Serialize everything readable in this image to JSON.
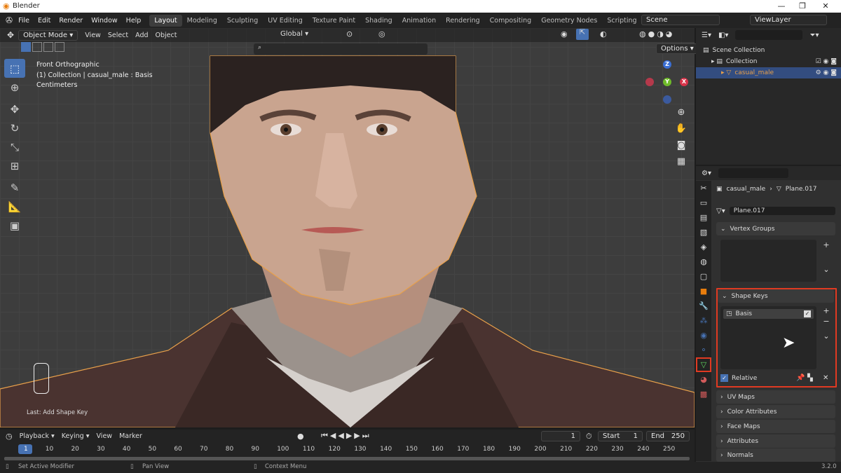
{
  "app": {
    "title": "Blender",
    "version": "3.2.0"
  },
  "menu": [
    "File",
    "Edit",
    "Render",
    "Window",
    "Help"
  ],
  "workspaces": [
    "Layout",
    "Modeling",
    "Sculpting",
    "UV Editing",
    "Texture Paint",
    "Shading",
    "Animation",
    "Rendering",
    "Compositing",
    "Geometry Nodes",
    "Scripting"
  ],
  "workspaces_active": "Layout",
  "scene": "Scene",
  "view_layer": "ViewLayer",
  "viewport": {
    "mode": "Object Mode",
    "menus": [
      "View",
      "Select",
      "Add",
      "Object"
    ],
    "transform": "Global",
    "options": "Options",
    "info": [
      "Front Orthographic",
      "(1) Collection | casual_male : Basis",
      "Centimeters"
    ],
    "last_op": "Last: Add Shape Key",
    "gizmo": {
      "x": "X",
      "y": "Y",
      "z": "Z"
    }
  },
  "outliner": {
    "rows": [
      "Scene Collection",
      "Collection",
      "casual_male"
    ]
  },
  "properties": {
    "breadcrumb_object": "casual_male",
    "breadcrumb_mesh": "Plane.017",
    "mesh_name": "Plane.017",
    "vertex_groups": "Vertex Groups",
    "shape_keys": "Shape Keys",
    "shape_key_item": "Basis",
    "relative": "Relative",
    "panels": [
      "UV Maps",
      "Color Attributes",
      "Face Maps",
      "Attributes",
      "Normals"
    ]
  },
  "timeline": {
    "menus": [
      "Playback",
      "Keying",
      "View",
      "Marker"
    ],
    "current": "1",
    "start_label": "Start",
    "start": "1",
    "end_label": "End",
    "end": "250",
    "frames": [
      "1",
      "10",
      "20",
      "30",
      "40",
      "50",
      "60",
      "70",
      "80",
      "90",
      "100",
      "110",
      "120",
      "130",
      "140",
      "150",
      "160",
      "170",
      "180",
      "190",
      "200",
      "210",
      "220",
      "230",
      "240",
      "250"
    ]
  },
  "status": {
    "left": "Set Active Modifier",
    "mid": "Pan View",
    "right": "Context Menu"
  },
  "colors": {
    "accent": "#4772b3",
    "highlight": "#e03a22",
    "selection": "#334d80",
    "outline": "#e8a04a"
  }
}
